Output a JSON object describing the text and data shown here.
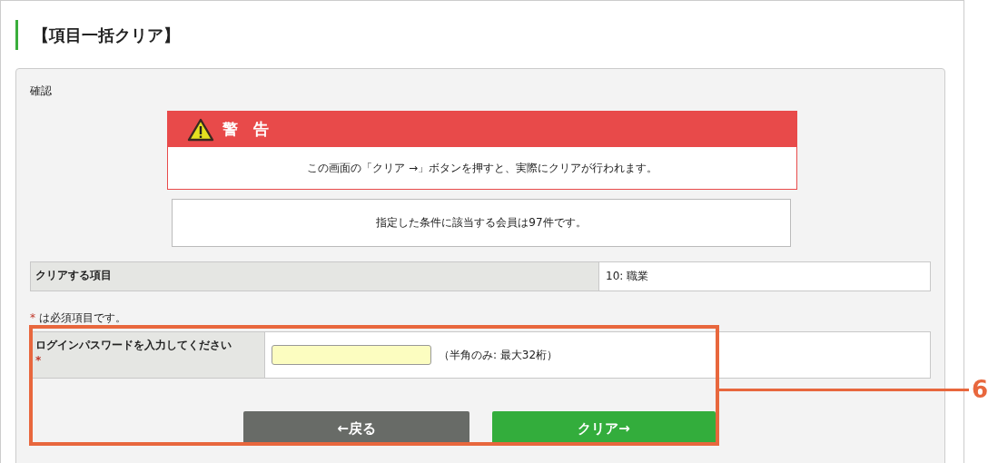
{
  "page_title": "【項目一括クリア】",
  "section_label": "確認",
  "warning": {
    "heading": "警　告",
    "message": "この画面の「クリア →」ボタンを押すと、実際にクリアが行われます。"
  },
  "info_message": "指定した条件に該当する会員は97件です。",
  "clear_item": {
    "label": "クリアする項目",
    "value": "10: 職業"
  },
  "required_note": {
    "mark": "*",
    "text": "は必須項目です。"
  },
  "password": {
    "label": "ログインパスワードを入力してください",
    "required_mark": "*",
    "hint": "（半角のみ: 最大32桁）"
  },
  "buttons": [
    {
      "kind": "back",
      "label": "←戻る"
    },
    {
      "kind": "submit",
      "label": "クリア→"
    }
  ],
  "callout": {
    "number": "6"
  }
}
